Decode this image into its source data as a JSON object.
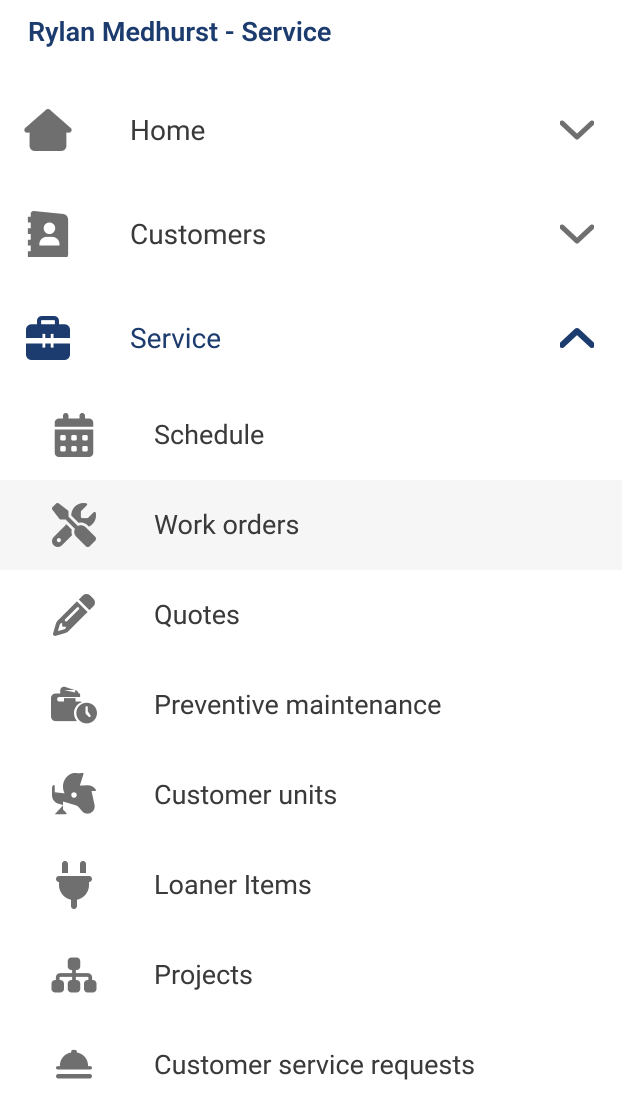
{
  "title": "Rylan Medhurst - Service",
  "nav": [
    {
      "id": "home",
      "label": "Home",
      "icon": "home",
      "expanded": false,
      "active": false
    },
    {
      "id": "customers",
      "label": "Customers",
      "icon": "contacts",
      "expanded": false,
      "active": false
    },
    {
      "id": "service",
      "label": "Service",
      "icon": "toolbox",
      "expanded": true,
      "active": true
    }
  ],
  "service_items": [
    {
      "id": "schedule",
      "label": "Schedule",
      "icon": "calendar",
      "active": false
    },
    {
      "id": "workorders",
      "label": "Work orders",
      "icon": "tools",
      "active": true
    },
    {
      "id": "quotes",
      "label": "Quotes",
      "icon": "pencil",
      "active": false
    },
    {
      "id": "preventive",
      "label": "Preventive maintenance",
      "icon": "briefcase-clock",
      "active": false
    },
    {
      "id": "units",
      "label": "Customer units",
      "icon": "fan",
      "active": false
    },
    {
      "id": "loaner",
      "label": "Loaner Items",
      "icon": "plug",
      "active": false
    },
    {
      "id": "projects",
      "label": "Projects",
      "icon": "sitemap",
      "active": false
    },
    {
      "id": "csr",
      "label": "Customer service requests",
      "icon": "bell",
      "active": false
    }
  ],
  "colors": {
    "navy": "#1c3b6e",
    "grey": "#6f6f6f",
    "text": "#3a3a3a",
    "hover": "#f6f6f6"
  }
}
